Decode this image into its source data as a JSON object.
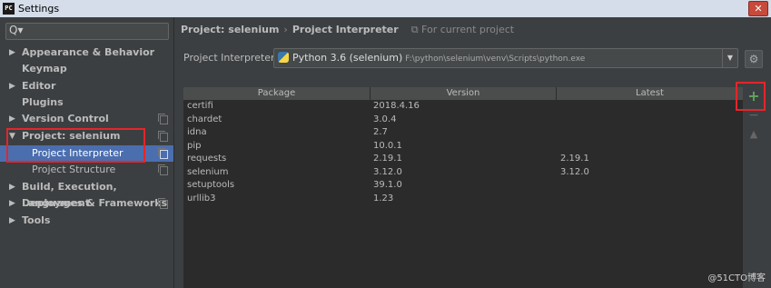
{
  "window": {
    "app_icon": "PC",
    "title": "Settings",
    "close_glyph": "✕"
  },
  "search": {
    "placeholder": "Q▾"
  },
  "sidebar": {
    "items": [
      {
        "label": "Appearance & Behavior",
        "arrow": "▶"
      },
      {
        "label": "Keymap",
        "arrow": ""
      },
      {
        "label": "Editor",
        "arrow": "▶"
      },
      {
        "label": "Plugins",
        "arrow": ""
      },
      {
        "label": "Version Control",
        "arrow": "▶"
      },
      {
        "label": "Project: selenium",
        "arrow": "▼"
      },
      {
        "label": "Project Interpreter",
        "arrow": ""
      },
      {
        "label": "Project Structure",
        "arrow": ""
      },
      {
        "label": "Build, Execution, Deployment",
        "arrow": "▶"
      },
      {
        "label": "Languages & Frameworks",
        "arrow": "▶"
      },
      {
        "label": "Tools",
        "arrow": "▶"
      }
    ]
  },
  "breadcrumb": {
    "project": "Project: selenium",
    "separator": "›",
    "page": "Project Interpreter",
    "scope": "For current project"
  },
  "interpreter": {
    "label": "Project Interpreter:",
    "name": "Python 3.6 (selenium)",
    "path": "F:\\python\\selenium\\venv\\Scripts\\python.exe",
    "dropdown_glyph": "▼"
  },
  "table": {
    "headers": {
      "package": "Package",
      "version": "Version",
      "latest": "Latest"
    },
    "rows": [
      {
        "package": "certifi",
        "version": "2018.4.16",
        "latest": ""
      },
      {
        "package": "chardet",
        "version": "3.0.4",
        "latest": ""
      },
      {
        "package": "idna",
        "version": "2.7",
        "latest": ""
      },
      {
        "package": "pip",
        "version": "10.0.1",
        "latest": ""
      },
      {
        "package": "requests",
        "version": "2.19.1",
        "latest": "2.19.1"
      },
      {
        "package": "selenium",
        "version": "3.12.0",
        "latest": "3.12.0"
      },
      {
        "package": "setuptools",
        "version": "39.1.0",
        "latest": ""
      },
      {
        "package": "urllib3",
        "version": "1.23",
        "latest": ""
      }
    ]
  },
  "tools": {
    "add": "+",
    "remove": "−",
    "upgrade": "▲",
    "gear": "⚙"
  },
  "watermark": "@51CTO博客",
  "icons": [
    "app-icon",
    "search-icon",
    "copy-icon",
    "python-icon",
    "gear-icon",
    "add-icon",
    "remove-icon",
    "upgrade-icon"
  ],
  "colors": {
    "selection": "#4b6eaf",
    "highlight_box": "#e3262b",
    "add_green": "#5ea55e"
  }
}
